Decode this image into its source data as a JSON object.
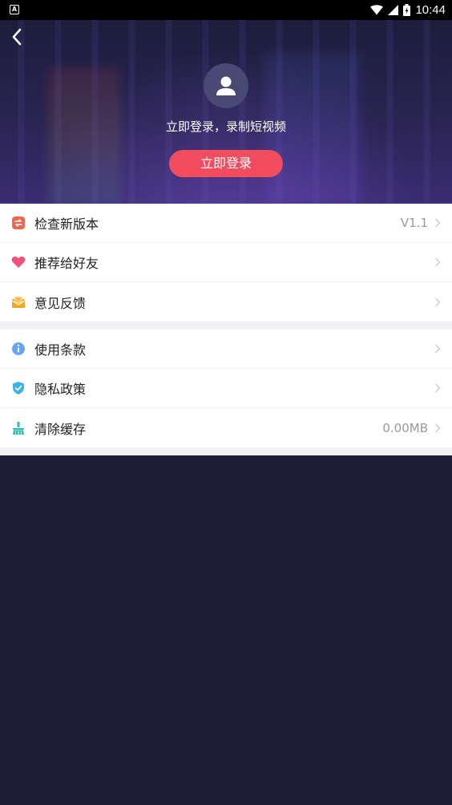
{
  "status_bar": {
    "notification_glyph": "A",
    "time": "10:44",
    "icons": [
      "wifi-icon",
      "signal-icon",
      "battery-icon"
    ]
  },
  "header": {
    "back_icon": "back-arrow-icon",
    "avatar_icon": "user-avatar-icon",
    "prompt": "立即登录，录制短视频",
    "login_button": "立即登录"
  },
  "menu": {
    "group1": [
      {
        "label": "检查新版本",
        "value": "V1.1",
        "icon": "update-icon",
        "icon_color": "#f0654e"
      },
      {
        "label": "推荐给好友",
        "value": "",
        "icon": "heart-icon",
        "icon_color": "#f2527a"
      },
      {
        "label": "意见反馈",
        "value": "",
        "icon": "feedback-mail-icon",
        "icon_color": "#f5a623"
      }
    ],
    "group2": [
      {
        "label": "使用条款",
        "value": "",
        "icon": "info-icon",
        "icon_color": "#6aa3f0"
      },
      {
        "label": "隐私政策",
        "value": "",
        "icon": "shield-check-icon",
        "icon_color": "#3fb3e8"
      },
      {
        "label": "清除缓存",
        "value": "0.00MB",
        "icon": "broom-icon",
        "icon_color": "#2ebfb2"
      }
    ]
  },
  "colors": {
    "accent": "#f24c5e",
    "page_background": "#1e1d38"
  }
}
